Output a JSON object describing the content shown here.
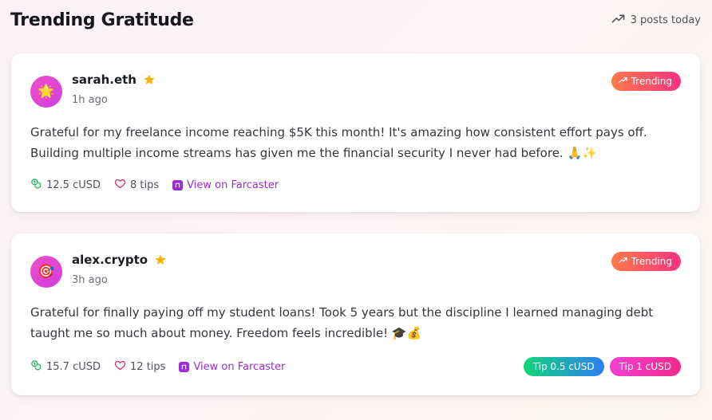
{
  "header": {
    "title": "Trending Gratitude",
    "posts_today": "3 posts today"
  },
  "colors": {
    "accent_purple": "#9d2bd6",
    "trending_gradient": [
      "#ff7a4a",
      "#f7337f"
    ],
    "tip_green_blue": [
      "#10d67a",
      "#2f7df2"
    ],
    "tip_pink": [
      "#f040d0",
      "#f02b8a"
    ],
    "star": "#f5b400"
  },
  "posts": [
    {
      "avatar_emoji": "🌟",
      "author": "sarah.eth",
      "time": "1h ago",
      "badge": "Trending",
      "content": "Grateful for my freelance income reaching $5K this month! It's amazing how consistent effort pays off. Building multiple income streams has given me the financial security I never had before. 🙏✨",
      "amount": "12.5 cUSD",
      "tips": "8 tips",
      "link": "View on Farcaster"
    },
    {
      "avatar_emoji": "🎯",
      "author": "alex.crypto",
      "time": "3h ago",
      "badge": "Trending",
      "content": "Grateful for finally paying off my student loans! Took 5 years but the discipline I learned managing debt taught me so much about money. Freedom feels incredible! 🎓💰",
      "amount": "15.7 cUSD",
      "tips": "12 tips",
      "link": "View on Farcaster",
      "tip_buttons": [
        "Tip 0.5 cUSD",
        "Tip 1 cUSD"
      ]
    }
  ]
}
